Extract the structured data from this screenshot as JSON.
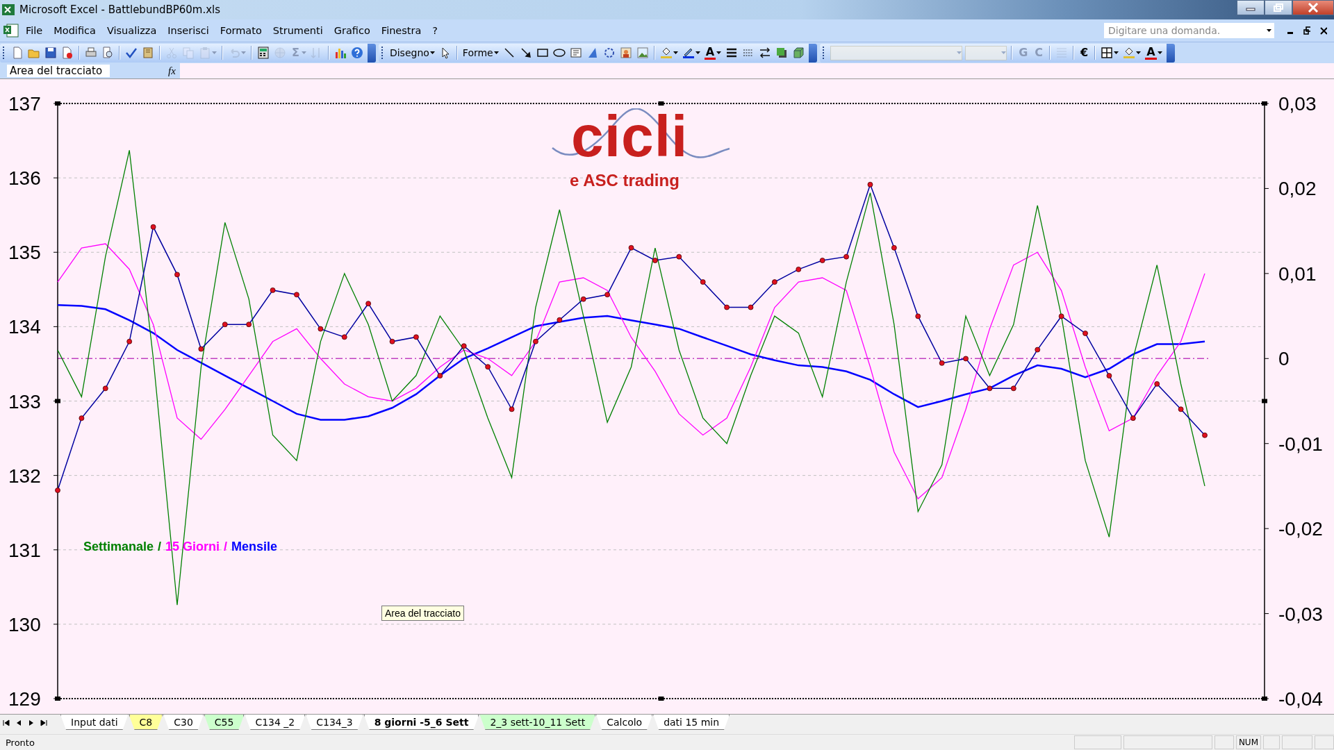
{
  "window": {
    "title": "Microsoft Excel - BattlebundBP60m.xls"
  },
  "menu": [
    "File",
    "Modifica",
    "Visualizza",
    "Inserisci",
    "Formato",
    "Strumenti",
    "Grafico",
    "Finestra",
    "?"
  ],
  "help_box": {
    "placeholder": "Digitare una domanda."
  },
  "standard_toolbar": [
    [
      {
        "kind": "new",
        "disabled": false
      },
      {
        "kind": "open",
        "disabled": false
      },
      {
        "kind": "save",
        "disabled": false
      },
      {
        "kind": "permission",
        "disabled": false
      }
    ],
    [
      {
        "kind": "print",
        "disabled": false
      },
      {
        "kind": "preview",
        "disabled": false
      }
    ],
    [
      {
        "kind": "spelling",
        "disabled": false
      },
      {
        "kind": "research",
        "disabled": false
      }
    ],
    [
      {
        "kind": "cut",
        "disabled": true
      },
      {
        "kind": "copy",
        "disabled": true
      },
      {
        "kind": "paste",
        "disabled": true,
        "dropdown": true
      }
    ],
    [
      {
        "kind": "undo",
        "disabled": true,
        "dropdown": true
      }
    ],
    [
      {
        "kind": "convert",
        "disabled": false
      },
      {
        "kind": "link",
        "disabled": true
      },
      {
        "kind": "glyph",
        "label": "Σ",
        "disabled": true,
        "dropdown": true
      },
      {
        "kind": "sort",
        "disabled": true
      }
    ],
    [
      {
        "kind": "chart",
        "disabled": false
      },
      {
        "kind": "help",
        "disabled": false
      }
    ]
  ],
  "drawing_toolbar": [
    [
      {
        "kind": "menu",
        "label": "Disegno",
        "disabled": false
      },
      {
        "kind": "pointer",
        "disabled": false
      }
    ],
    [
      {
        "kind": "menu",
        "label": "Forme",
        "disabled": false
      },
      {
        "kind": "line",
        "disabled": false
      },
      {
        "kind": "arrow",
        "disabled": false
      },
      {
        "kind": "rectangle",
        "disabled": false
      },
      {
        "kind": "ellipse",
        "disabled": false
      },
      {
        "kind": "textbox",
        "disabled": false
      },
      {
        "kind": "wordart",
        "disabled": false
      },
      {
        "kind": "diagram",
        "disabled": false
      },
      {
        "kind": "clipart",
        "disabled": false
      },
      {
        "kind": "image",
        "disabled": false
      }
    ],
    [
      {
        "kind": "fill",
        "disabled": false,
        "dropdown": true
      },
      {
        "kind": "pen",
        "disabled": false,
        "dropdown": true
      },
      {
        "kind": "font-color",
        "label": "A",
        "disabled": false,
        "dropdown": true
      },
      {
        "kind": "linestyle",
        "disabled": false
      },
      {
        "kind": "dashstyle",
        "disabled": false
      },
      {
        "kind": "arrowstyle",
        "disabled": false
      },
      {
        "kind": "shadow",
        "disabled": false
      },
      {
        "kind": "cube",
        "disabled": false
      }
    ]
  ],
  "formatting_toolbar": [
    [
      {
        "kind": "combo",
        "disabled": true
      },
      {
        "kind": "combo-small",
        "disabled": true
      }
    ],
    [
      {
        "kind": "glyph",
        "label": "G",
        "disabled": true
      },
      {
        "kind": "glyph",
        "label": "C",
        "disabled": true
      }
    ],
    [
      {
        "kind": "align",
        "disabled": true
      }
    ],
    [
      {
        "kind": "glyph",
        "label": "€",
        "disabled": false
      }
    ],
    [
      {
        "kind": "borders",
        "disabled": false,
        "dropdown": true
      },
      {
        "kind": "fill",
        "disabled": false,
        "dropdown": true
      },
      {
        "kind": "font-color",
        "label": "A",
        "disabled": false,
        "dropdown": true
      }
    ]
  ],
  "formula_bar": {
    "name_box": "Area del tracciato",
    "function_label": "fx"
  },
  "chart": {
    "logo": {
      "title": "cicli",
      "subtitle": "e ASC trading"
    },
    "legend_separators": [
      "/",
      "/"
    ],
    "tooltip": "Area del tracciato",
    "chart_data": {
      "type": "line",
      "grid": true,
      "ylim": [
        129,
        137
      ],
      "yticks": [
        129,
        130,
        131,
        132,
        133,
        134,
        135,
        136,
        137
      ],
      "y2lim": [
        -0.04,
        0.03
      ],
      "y2ticks": [
        {
          "value": 0.03,
          "label": "0,03"
        },
        {
          "value": 0.02,
          "label": "0,02"
        },
        {
          "value": 0.01,
          "label": "0,01"
        },
        {
          "value": 0,
          "label": "0"
        },
        {
          "value": -0.01,
          "label": "-0,01"
        },
        {
          "value": -0.02,
          "label": "-0,02"
        },
        {
          "value": -0.03,
          "label": "-0,03"
        },
        {
          "value": -0.04,
          "label": "-0,04"
        }
      ],
      "ref_lines": [
        {
          "axis": "y2",
          "value": 0
        }
      ],
      "series": [
        {
          "color": "#0000a0",
          "marker": true,
          "values": [
            131.8,
            132.77,
            133.17,
            133.8,
            135.34,
            134.7,
            133.7,
            134.03,
            134.03,
            134.49,
            134.43,
            133.97,
            133.86,
            134.31,
            133.8,
            133.86,
            133.34,
            133.74,
            133.46,
            132.89,
            133.8,
            134.09,
            134.37,
            134.43,
            135.06,
            134.89,
            134.94,
            134.6,
            134.26,
            134.26,
            134.6,
            134.77,
            134.89,
            134.94,
            135.91,
            135.06,
            134.14,
            133.51,
            133.57,
            133.17,
            133.17,
            133.69,
            134.14,
            133.91,
            133.34,
            132.77,
            133.23,
            132.89,
            132.54
          ]
        },
        {
          "name": "Settimanale",
          "color": "#008000",
          "axis": "y2",
          "values": [
            0.001,
            -0.0045,
            0.012,
            0.0245,
            0,
            -0.029,
            -0.001,
            0.016,
            0.007,
            -0.009,
            -0.012,
            0.002,
            0.01,
            0.004,
            -0.005,
            -0.002,
            0.005,
            0.001,
            -0.007,
            -0.014,
            0.006,
            0.0175,
            0.005,
            -0.0075,
            -0.001,
            0.013,
            0.001,
            -0.007,
            -0.01,
            -0.002,
            0.005,
            0.003,
            -0.0045,
            0.009,
            0.0195,
            0.004,
            -0.018,
            -0.0125,
            0.005,
            -0.002,
            0.004,
            0.018,
            0.005,
            -0.012,
            -0.021,
            0,
            0.011,
            -0.003,
            -0.015
          ]
        },
        {
          "name": "15 Giorni",
          "color": "#ff00ff",
          "axis": "y2",
          "values": [
            0.009,
            0.013,
            0.0135,
            0.0105,
            0.004,
            -0.007,
            -0.0095,
            -0.006,
            -0.002,
            0.002,
            0.0035,
            0,
            -0.003,
            -0.0045,
            -0.005,
            -0.0035,
            -0.001,
            0.001,
            0,
            -0.002,
            0.002,
            0.009,
            0.0095,
            0.008,
            0.0025,
            -0.0015,
            -0.0065,
            -0.009,
            -0.007,
            -0.001,
            0.006,
            0.009,
            0.0095,
            0.008,
            -0.001,
            -0.011,
            -0.0165,
            -0.014,
            -0.006,
            0.0035,
            0.011,
            0.0125,
            0.008,
            -0.001,
            -0.0085,
            -0.007,
            -0.002,
            0.002,
            0.01
          ]
        },
        {
          "name": "Mensile",
          "color": "#0000ff",
          "axis": "y2",
          "values": [
            0.0063,
            0.0062,
            0.0058,
            0.0045,
            0.003,
            0.001,
            -0.0005,
            -0.002,
            -0.0035,
            -0.005,
            -0.0065,
            -0.0072,
            -0.0072,
            -0.0068,
            -0.0058,
            -0.0042,
            -0.002,
            0,
            0.0012,
            0.0025,
            0.0038,
            0.0043,
            0.0048,
            0.005,
            0.0045,
            0.004,
            0.0035,
            0.0025,
            0.0015,
            0.0005,
            -0.0002,
            -0.0008,
            -0.001,
            -0.0015,
            -0.0025,
            -0.0042,
            -0.0057,
            -0.005,
            -0.0042,
            -0.0035,
            -0.002,
            -0.0008,
            -0.0012,
            -0.0022,
            -0.0012,
            0.0005,
            0.0017,
            0.0017,
            0.002
          ]
        }
      ]
    }
  },
  "sheet_tabs": [
    {
      "label": "Input dati",
      "color": "#ffffff",
      "selected": false
    },
    {
      "label": "C8",
      "color": "#ffff99",
      "selected": false
    },
    {
      "label": "C30",
      "color": "#ffffff",
      "selected": false
    },
    {
      "label": "C55",
      "color": "#ccffcc",
      "selected": false
    },
    {
      "label": "C134 _2",
      "color": "#ffffff",
      "selected": false
    },
    {
      "label": "C134_3",
      "color": "#ffffff",
      "selected": false
    },
    {
      "label": "8 giorni -5_6 Sett",
      "color": "#ffffff",
      "selected": true
    },
    {
      "label": "2_3 sett-10_11 Sett",
      "color": "#ccffcc",
      "selected": false
    },
    {
      "label": "Calcolo",
      "color": "#ffffff",
      "selected": false
    },
    {
      "label": "dati 15 min",
      "color": "#ffffff",
      "selected": false
    }
  ],
  "status_bar": {
    "status": "Pronto",
    "indicators": [
      "NUM"
    ]
  }
}
